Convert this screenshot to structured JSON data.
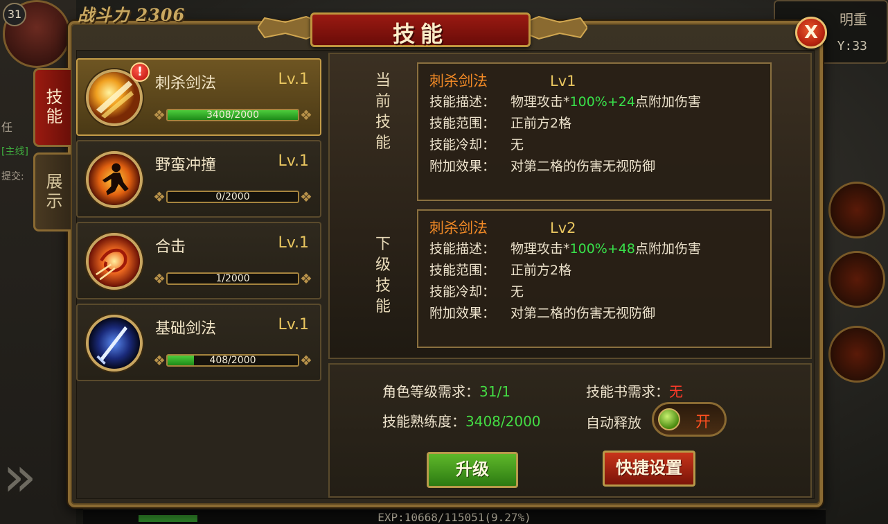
{
  "hud": {
    "player_level": "31",
    "combat_power_label": "战斗力",
    "combat_power_value": "2306",
    "map_name": "明重",
    "map_coord": "Y:33",
    "side_text_1": "任",
    "side_text_2": "[主线]",
    "side_text_3": "提交:",
    "exp_text": "EXP:10668/115051(9.27%)"
  },
  "window": {
    "title": "技能",
    "close_label": "X"
  },
  "tabs": [
    {
      "label": "技能",
      "active": true
    },
    {
      "label": "展示",
      "active": false
    }
  ],
  "skills": [
    {
      "name": "刺杀剑法",
      "level": "Lv.1",
      "progress": "3408/2000",
      "fill_pct": 100,
      "alert": "!",
      "icon": "slash-skill-icon"
    },
    {
      "name": "野蛮冲撞",
      "level": "Lv.1",
      "progress": "0/2000",
      "fill_pct": 0,
      "icon": "charge-skill-icon"
    },
    {
      "name": "合击",
      "level": "Lv.1",
      "progress": "1/2000",
      "fill_pct": 0.05,
      "icon": "combo-skill-icon"
    },
    {
      "name": "基础剑法",
      "level": "Lv.1",
      "progress": "408/2000",
      "fill_pct": 20.4,
      "icon": "basic-sword-icon"
    }
  ],
  "current_skill": {
    "section_label": "当前技能",
    "name": "刺杀剑法",
    "level": "Lv1",
    "rows": {
      "desc_label": "技能描述：",
      "desc_prefix": "物理攻击*",
      "desc_value": "100%+24",
      "desc_suffix": "点附加伤害",
      "range_label": "技能范围：",
      "range_value": "正前方2格",
      "cd_label": "技能冷却：",
      "cd_value": "无",
      "effect_label": "附加效果：",
      "effect_value": "对第二格的伤害无视防御"
    }
  },
  "next_skill": {
    "section_label": "下级技能",
    "name": "刺杀剑法",
    "level": "Lv2",
    "rows": {
      "desc_label": "技能描述：",
      "desc_prefix": "物理攻击*",
      "desc_value": "100%+48",
      "desc_suffix": "点附加伤害",
      "range_label": "技能范围：",
      "range_value": "正前方2格",
      "cd_label": "技能冷却：",
      "cd_value": "无",
      "effect_label": "附加效果：",
      "effect_value": "对第二格的伤害无视防御"
    }
  },
  "requirements": {
    "role_level_label": "角色等级需求：",
    "role_level_value": "31/1",
    "book_label": "技能书需求：",
    "book_value": "无",
    "proficiency_label": "技能熟练度：",
    "proficiency_value": "3408/2000",
    "auto_cast_label": "自动释放",
    "auto_cast_state": "开"
  },
  "buttons": {
    "upgrade": "升级",
    "shortcut": "快捷设置"
  },
  "colors": {
    "accent_gold": "#c49c48",
    "title_red": "#9a1a12",
    "value_green": "#38e04a",
    "skill_orange": "#f28a26"
  }
}
